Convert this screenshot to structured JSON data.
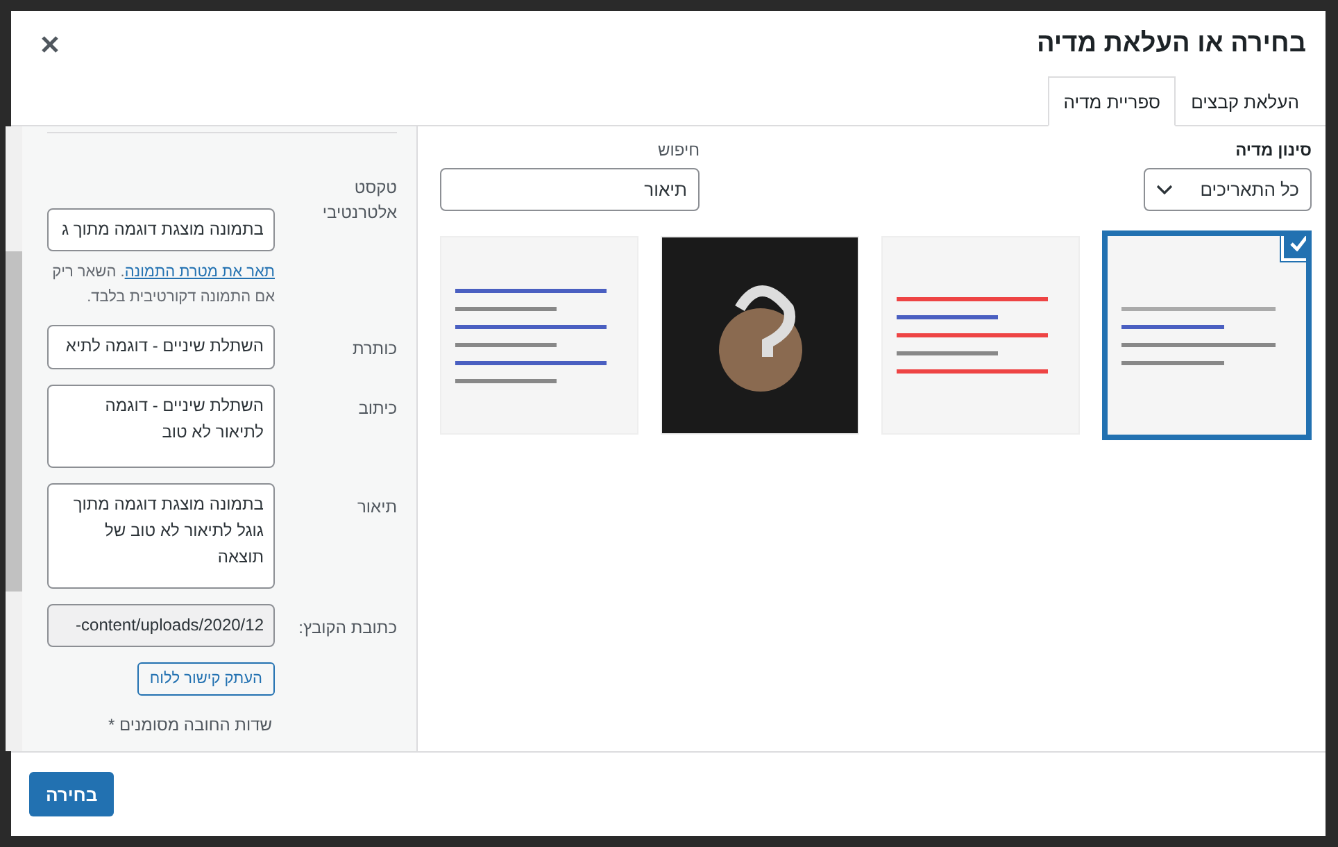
{
  "dialog": {
    "title": "בחירה או העלאת מדיה"
  },
  "tabs": [
    {
      "label": "העלאת קבצים",
      "selected": false
    },
    {
      "label": "ספריית מדיה",
      "selected": true
    }
  ],
  "filter": {
    "label": "סינון מדיה",
    "value": "כל התאריכים"
  },
  "search": {
    "label": "חיפוש",
    "value": "תיאור"
  },
  "thumbnails": [
    {
      "kind": "screenshot",
      "selected": true
    },
    {
      "kind": "screenshot",
      "selected": false
    },
    {
      "kind": "photo",
      "selected": false
    },
    {
      "kind": "screenshot",
      "selected": false
    }
  ],
  "details": {
    "alt_text": {
      "label": "טקסט אלטרנטיבי",
      "value": "בתמונה מוצגת דוגמה מתוך ג"
    },
    "alt_help": {
      "link": "תאר את מטרת התמונה",
      "text": ". השאר ריק אם התמונה דקורטיבית בלבד."
    },
    "title": {
      "label": "כותרת",
      "value": "השתלת שיניים - דוגמה לתיא"
    },
    "caption": {
      "label": "כיתוב",
      "value": "השתלת שיניים - דוגמה לתיאור לא טוב"
    },
    "description": {
      "label": "תיאור",
      "value": "בתמונה מוצגת דוגמה מתוך גוגל לתיאור לא טוב של תוצאה"
    },
    "file_url": {
      "label": "כתובת הקובץ:",
      "value": "-content/uploads/2020/12"
    },
    "copy_button": "העתק קישור ללוח",
    "required_note": "שדות החובה מסומנים *"
  },
  "footer": {
    "select_button": "בחירה"
  }
}
